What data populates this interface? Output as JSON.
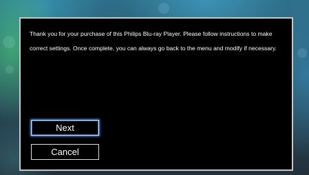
{
  "dialog": {
    "message": "Thank you for your purchase of this Philips Blu-ray Player. Please follow instructions to make correct settings.  Once complete, you can always go back to the menu and modify if necessary.",
    "buttons": {
      "next_label": "Next",
      "cancel_label": "Cancel"
    },
    "focused_button": "Next"
  },
  "colors": {
    "dialog_background": "#000000",
    "dialog_border": "#c9c9c9",
    "text": "#ffffff",
    "focus_highlight": "#2f6fd1"
  }
}
